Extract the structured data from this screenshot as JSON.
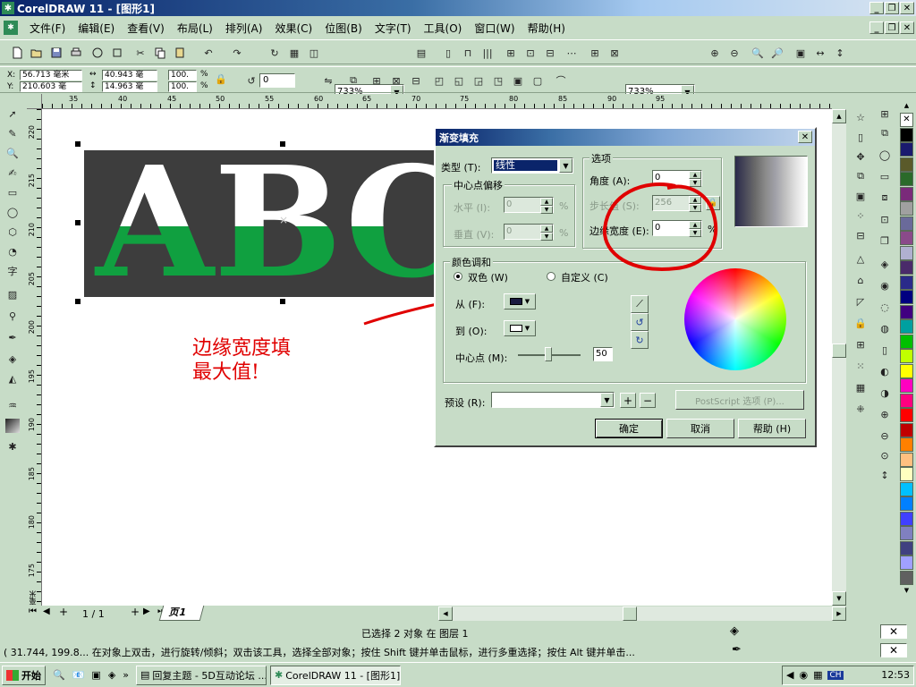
{
  "window": {
    "title": "CorelDRAW 11 - [图形1]"
  },
  "menu": [
    {
      "label": "文件(F)"
    },
    {
      "label": "编辑(E)"
    },
    {
      "label": "查看(V)"
    },
    {
      "label": "布局(L)"
    },
    {
      "label": "排列(A)"
    },
    {
      "label": "效果(C)"
    },
    {
      "label": "位图(B)"
    },
    {
      "label": "文字(T)"
    },
    {
      "label": "工具(O)"
    },
    {
      "label": "窗口(W)"
    },
    {
      "label": "帮助(H)"
    }
  ],
  "toolbar": {
    "zoom_left": "733%",
    "zoom_right": "733%"
  },
  "propbar": {
    "x": "56.713 毫米",
    "y": "210.603 毫",
    "w": "40.943 毫",
    "h": "14.963 毫",
    "scale_x": "100.",
    "scale_y": "100.",
    "percent": "%",
    "angle": "0"
  },
  "rulers": {
    "h_ticks": [
      "35",
      "40",
      "45",
      "50",
      "55",
      "60",
      "65",
      "70",
      "75",
      "80",
      "85",
      "90",
      "95"
    ],
    "v_ticks": [
      "220",
      "215",
      "210",
      "205",
      "200",
      "195",
      "190",
      "185",
      "180",
      "175",
      "毫米"
    ]
  },
  "canvas": {
    "artwork_text": "ABC",
    "annotation_line1": "边缘宽度填",
    "annotation_line2": "最大值!"
  },
  "dialog": {
    "title": "渐变填充",
    "type_label": "类型 (T):",
    "type_value": "线性",
    "center_offset_group": "中心点偏移",
    "horizontal_label": "水平 (I):",
    "horizontal_value": "0",
    "vertical_label": "垂直 (V):",
    "vertical_value": "0",
    "options_group": "选项",
    "angle_label": "角度 (A):",
    "angle_value": "0",
    "steps_label": "步长值 (S):",
    "steps_value": "256",
    "edge_label": "边缘宽度 (E):",
    "edge_value": "0",
    "percent": "%",
    "blend_group": "颜色调和",
    "two_color_label": "双色 (W)",
    "custom_label": "自定义 (C)",
    "from_label": "从 (F):",
    "to_label": "到 (O):",
    "midpoint_label": "中心点 (M):",
    "midpoint_value": "50",
    "preset_label": "预设 (R):",
    "postscript_label": "PostScript 选项 (P)...",
    "ok_label": "确定",
    "cancel_label": "取消",
    "help_label": "帮助 (H)"
  },
  "page_nav": {
    "page_count": "1 / 1",
    "page_tab": "页1"
  },
  "status": {
    "selection": "已选择 2 对象 在 图层 1",
    "hint": "( 31.744, 199.8...  在对象上双击，进行旋转/倾斜；双击该工具，选择全部对象；按住 Shift 键并单击鼠标，进行多重选择；按住 Alt 键并单击..."
  },
  "taskbar": {
    "start": "开始",
    "task1": "回复主题 - 5D互动论坛 ...",
    "task2": "CorelDRAW 11 - [图形1]",
    "ime": "CH",
    "clock": "12:53"
  },
  "colors": {
    "ui_bg": "#c7dcc7",
    "art_dark": "#3d3d3d",
    "art_green": "#10a040",
    "annotation_red": "#e00000"
  },
  "palette": [
    "#ffffff",
    "#000000",
    "#1a1a6e",
    "#5a5a2a",
    "#2a6a2a",
    "#7a2a7a",
    "#a0a0a0",
    "#6a6a9a",
    "#8a4a8a",
    "#b0b0d0",
    "#4a2a6a",
    "#2a2a8a",
    "#000080",
    "#400080",
    "#00a0a0",
    "#00c000",
    "#c0ff00",
    "#ffff00",
    "#ff00c0",
    "#ff0080",
    "#ff0000",
    "#c00000",
    "#ff8000",
    "#ffc080",
    "#ffffc0",
    "#00c0ff",
    "#0080ff",
    "#4040ff",
    "#8080c0",
    "#404080",
    "#a0a0ff",
    "#606060"
  ]
}
